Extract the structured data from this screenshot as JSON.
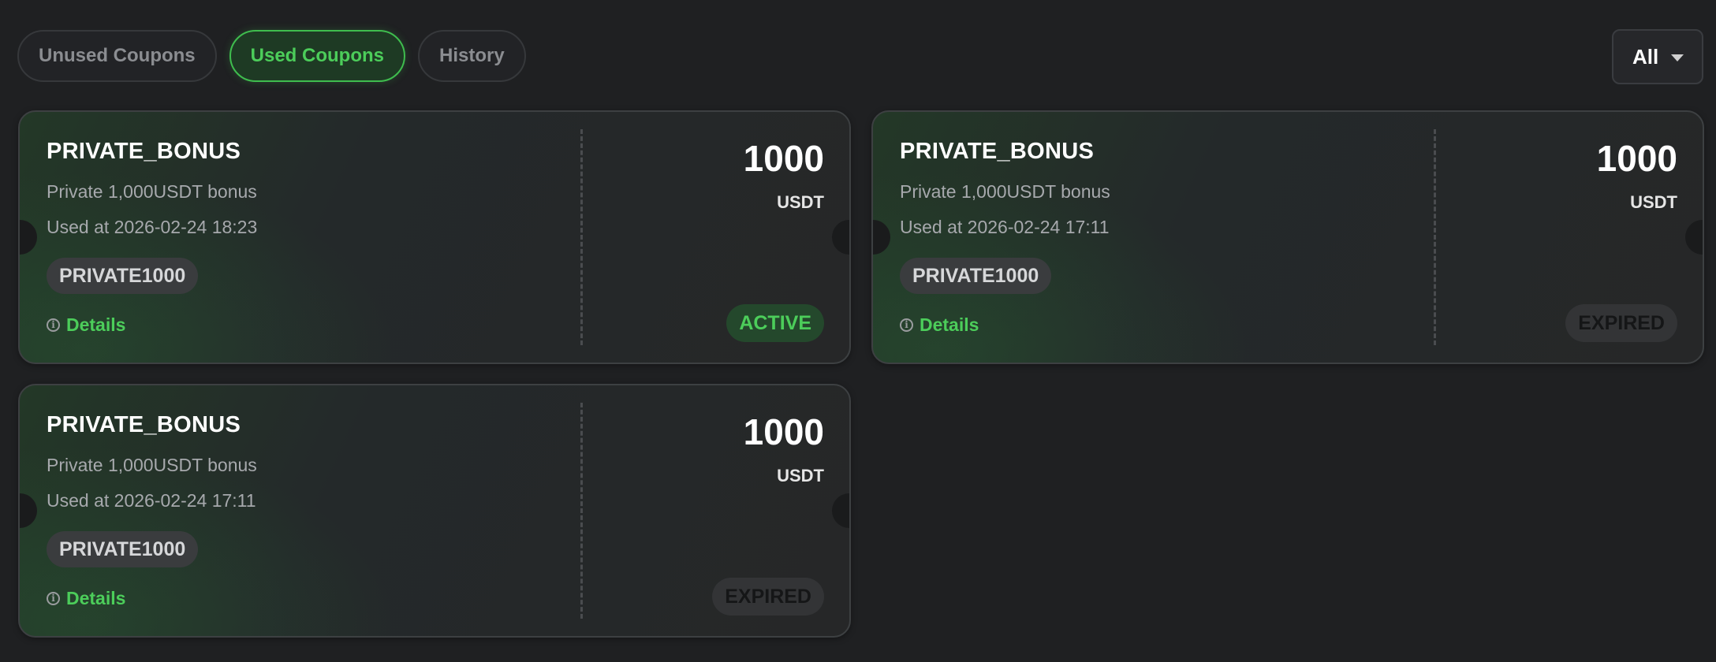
{
  "tabs": [
    {
      "label": "Unused Coupons",
      "active": false
    },
    {
      "label": "Used Coupons",
      "active": true
    },
    {
      "label": "History",
      "active": false
    }
  ],
  "filter": {
    "selected": "All",
    "icon": "chevron-down-icon"
  },
  "colors": {
    "accent_green": "#4ccd5a",
    "background": "#1f2022",
    "card_border": "#3d4042"
  },
  "coupons": [
    {
      "name": "PRIVATE_BONUS",
      "description": "Private 1,000USDT bonus",
      "used_at": "Used at 2026-02-24 18:23",
      "code": "PRIVATE1000",
      "details_label": "Details",
      "amount": "1000",
      "currency": "USDT",
      "status": "ACTIVE"
    },
    {
      "name": "PRIVATE_BONUS",
      "description": "Private 1,000USDT bonus",
      "used_at": "Used at 2026-02-24 17:11",
      "code": "PRIVATE1000",
      "details_label": "Details",
      "amount": "1000",
      "currency": "USDT",
      "status": "EXPIRED"
    },
    {
      "name": "PRIVATE_BONUS",
      "description": "Private 1,000USDT bonus",
      "used_at": "Used at 2026-02-24 17:11",
      "code": "PRIVATE1000",
      "details_label": "Details",
      "amount": "1000",
      "currency": "USDT",
      "status": "EXPIRED"
    }
  ]
}
